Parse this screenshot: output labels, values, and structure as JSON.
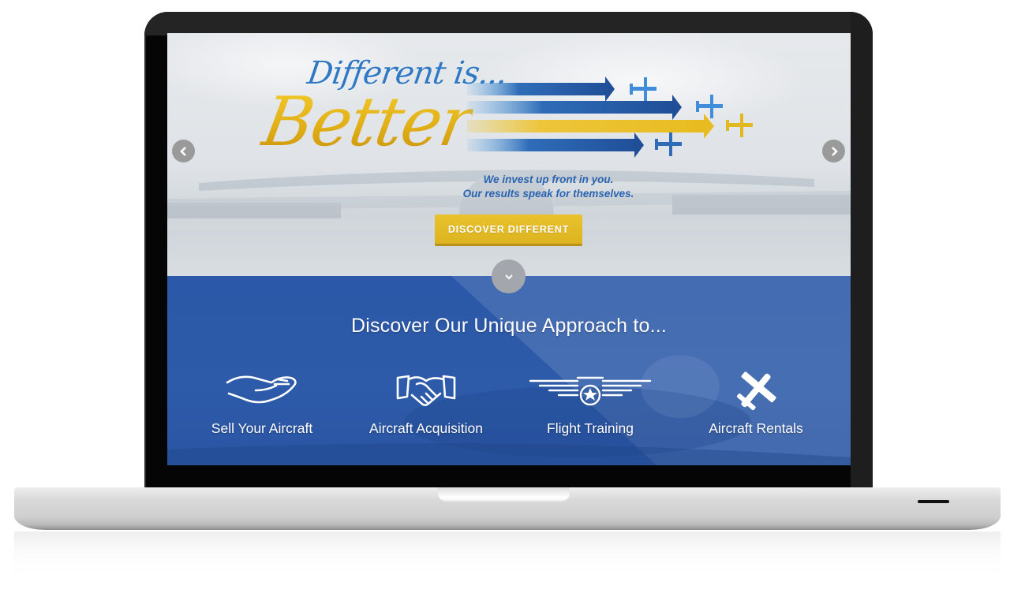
{
  "hero": {
    "headline_line1": "Different is...",
    "headline_line2": "Better",
    "subline_1": "We invest up front in you.",
    "subline_2": "Our results speak for themselves.",
    "cta_label": "DISCOVER DIFFERENT",
    "prev_icon": "chevron-left-icon",
    "next_icon": "chevron-right-icon",
    "scroll_icon": "chevron-down-icon"
  },
  "approach": {
    "title": "Discover Our Unique Approach to...",
    "services": [
      {
        "label": "Sell Your Aircraft",
        "icon": "open-hand-icon"
      },
      {
        "label": "Aircraft Acquisition",
        "icon": "handshake-icon"
      },
      {
        "label": "Flight Training",
        "icon": "pilot-wings-icon"
      },
      {
        "label": "Aircraft Rentals",
        "icon": "airplane-icon"
      }
    ]
  },
  "colors": {
    "brand_blue": "#2b58a8",
    "brand_yellow": "#e5b71c",
    "tagline_blue": "#2f78c4"
  }
}
